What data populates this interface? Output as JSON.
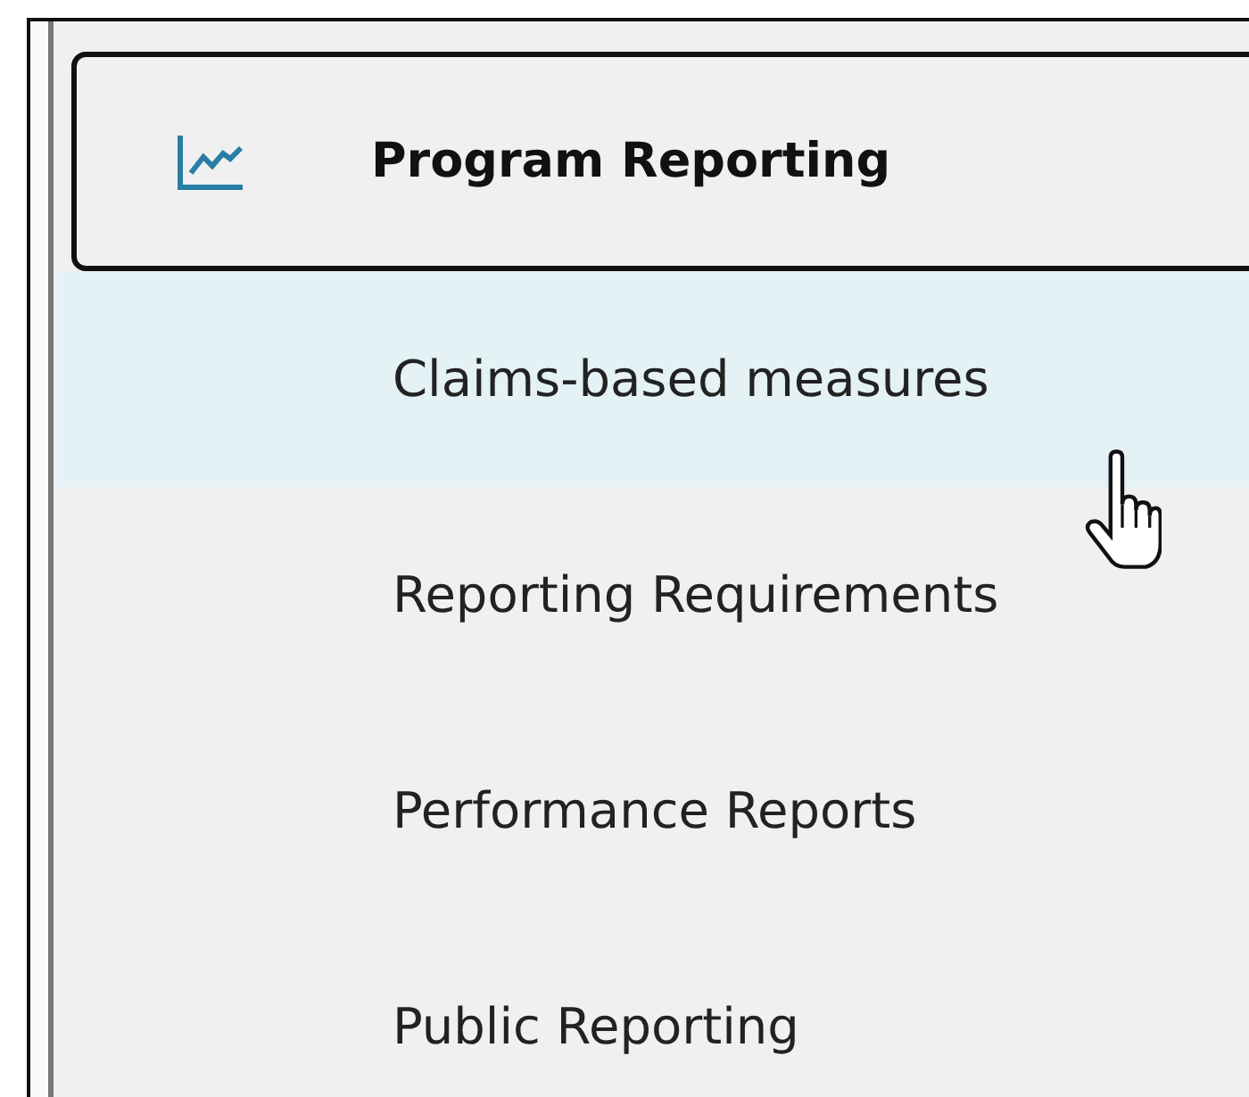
{
  "header": {
    "title": "Program Reporting"
  },
  "items": [
    {
      "label": "Claims-based measures",
      "highlighted": true
    },
    {
      "label": "Reporting Requirements",
      "highlighted": false
    },
    {
      "label": "Performance Reports",
      "highlighted": false
    },
    {
      "label": "Public Reporting",
      "highlighted": false
    }
  ]
}
